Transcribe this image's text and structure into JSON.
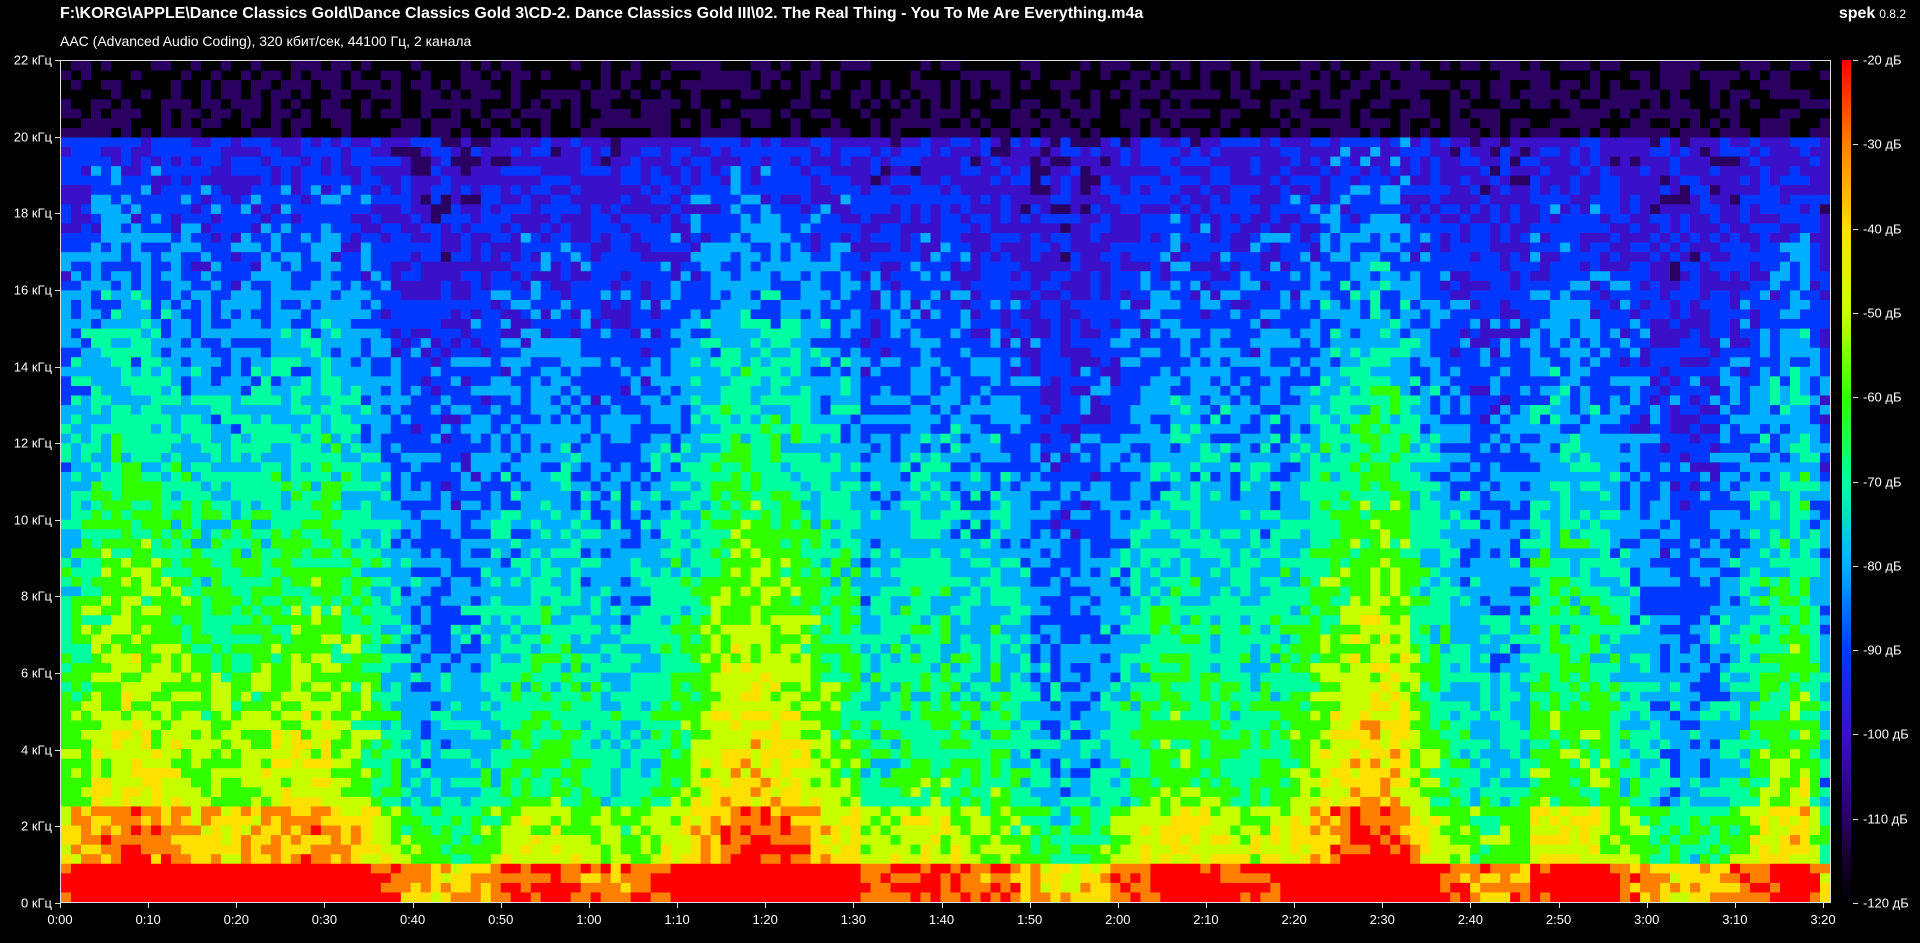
{
  "header": {
    "file_path": "F:\\KORG\\APPLE\\Dance Classics Gold\\Dance Classics Gold 3\\CD-2. Dance Classics Gold III\\02. The Real Thing - You To Me Are Everything.m4a",
    "stream_info": "AAC (Advanced Audio Coding), 320 кбит/сек, 44100 Гц, 2 канала"
  },
  "brand": {
    "name": "spek",
    "version": "0.8.2"
  },
  "chart_data": {
    "type": "heatmap",
    "title": "",
    "xlabel": "",
    "ylabel": "",
    "x_ticks": [
      "0:00",
      "0:10",
      "0:20",
      "0:30",
      "0:40",
      "0:50",
      "1:00",
      "1:10",
      "1:20",
      "1:30",
      "1:40",
      "1:50",
      "2:00",
      "2:10",
      "2:20",
      "2:30",
      "2:40",
      "2:50",
      "3:00",
      "3:10",
      "3:20"
    ],
    "y_ticks": [
      "22 кГц",
      "20 кГц",
      "18 кГц",
      "16 кГц",
      "14 кГц",
      "12 кГц",
      "10 кГц",
      "8 кГц",
      "6 кГц",
      "4 кГц",
      "2 кГц",
      "0 кГц"
    ],
    "xlim": [
      0,
      200
    ],
    "ylim": [
      0,
      22
    ],
    "colorbar_ticks": [
      "-20 дБ",
      "-30 дБ",
      "-40 дБ",
      "-50 дБ",
      "-60 дБ",
      "-70 дБ",
      "-80 дБ",
      "-90 дБ",
      "-100 дБ",
      "-110 дБ",
      "-120 дБ"
    ],
    "colorbar_range_db": [
      -120,
      -20
    ],
    "colormap": [
      "#000000",
      "#2a0060",
      "#3a10c8",
      "#0038ff",
      "#00b0ff",
      "#00ffa0",
      "#30ff00",
      "#c8ff00",
      "#ffe000",
      "#ff8000",
      "#ff0000"
    ],
    "spectral_cutoff_khz": 20,
    "track_end_seconds": 200
  }
}
